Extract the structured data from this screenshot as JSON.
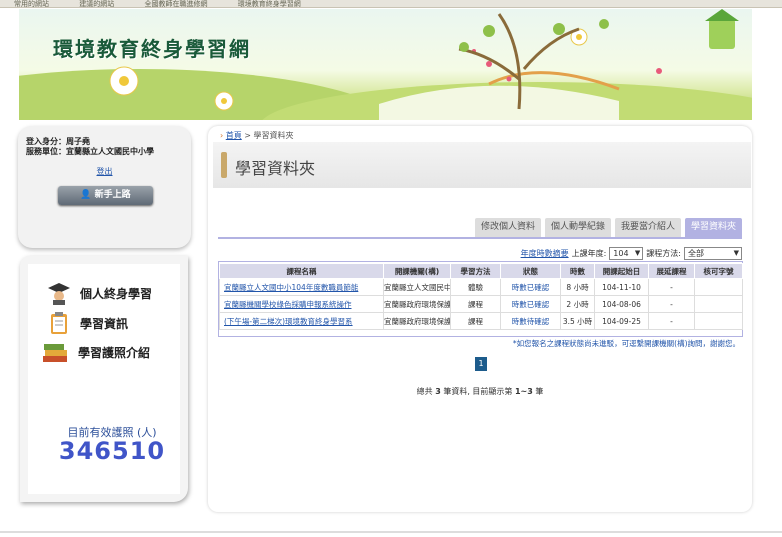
{
  "site": {
    "title": "環境教育終身學習網"
  },
  "user": {
    "identity_label": "登入身分：",
    "identity_value": "周子堯",
    "unit_label": "服務單位：",
    "unit_value": "宜蘭縣立人文國民中小學",
    "logout": "登出",
    "newbie_button": "新手上路"
  },
  "menu": {
    "items": [
      {
        "label": "個人終身學習",
        "icon": "graduate-icon"
      },
      {
        "label": "學習資訊",
        "icon": "clipboard-icon"
      },
      {
        "label": "學習護照介紹",
        "icon": "books-icon"
      }
    ],
    "count_label": "目前有效護照 (人)",
    "count_value": "346510"
  },
  "breadcrumb": {
    "home": "首頁",
    "separator": " > ",
    "current": "學習資料夾"
  },
  "page": {
    "title": "學習資料夾"
  },
  "tabs": [
    {
      "label": "修改個人資料",
      "active": false
    },
    {
      "label": "個人動學紀錄",
      "active": false
    },
    {
      "label": "我要當介紹人",
      "active": false
    },
    {
      "label": "學習資料夾",
      "active": true
    }
  ],
  "filter": {
    "summary_link": "年度時數摘要",
    "year_label": "上課年度:",
    "year_value": "104",
    "method_label": "課程方法:",
    "method_value": "全部"
  },
  "table": {
    "headers": [
      "課程名稱",
      "開課機關(構)",
      "學習方法",
      "狀態",
      "時數",
      "開課起始日",
      "展延課程",
      "核可字號"
    ],
    "rows": [
      {
        "course": "宜蘭縣立人文國中小104年度數職員節能",
        "org": "宜蘭縣立人文國民中",
        "method": "體驗",
        "status": "時數已確認",
        "hours": "8 小時",
        "start": "104-11-10",
        "extend": "-",
        "approval": ""
      },
      {
        "course": "宜蘭縣機關學校綠色採購申報系統操作",
        "org": "宜蘭縣政府環境保護",
        "method": "課程",
        "status": "時數已確認",
        "hours": "2 小時",
        "start": "104-08-06",
        "extend": "-",
        "approval": ""
      },
      {
        "course": "(下午場-第二梯次)環境教育終身學習系",
        "org": "宜蘭縣政府環境保護",
        "method": "課程",
        "status": "時數待確認",
        "hours": "3.5 小時",
        "start": "104-09-25",
        "extend": "-",
        "approval": ""
      }
    ]
  },
  "note": "*如您報名之課程狀態尚未進駁，可逕繫開課機關(構)詢問，謝謝您。",
  "pager": {
    "current": "1"
  },
  "summary": {
    "prefix": "總共 ",
    "total": "3",
    "mid": " 筆資料, 目前顯示第 ",
    "range": "1~3",
    "suffix": " 筆"
  },
  "topbar": [
    "常用的網站",
    "建議的網站",
    "全國教師在職進修網",
    "環境教育終身學習網"
  ],
  "colors": {
    "accent": "#b2b2e2",
    "link": "#2255aa",
    "count": "#4055c8"
  }
}
